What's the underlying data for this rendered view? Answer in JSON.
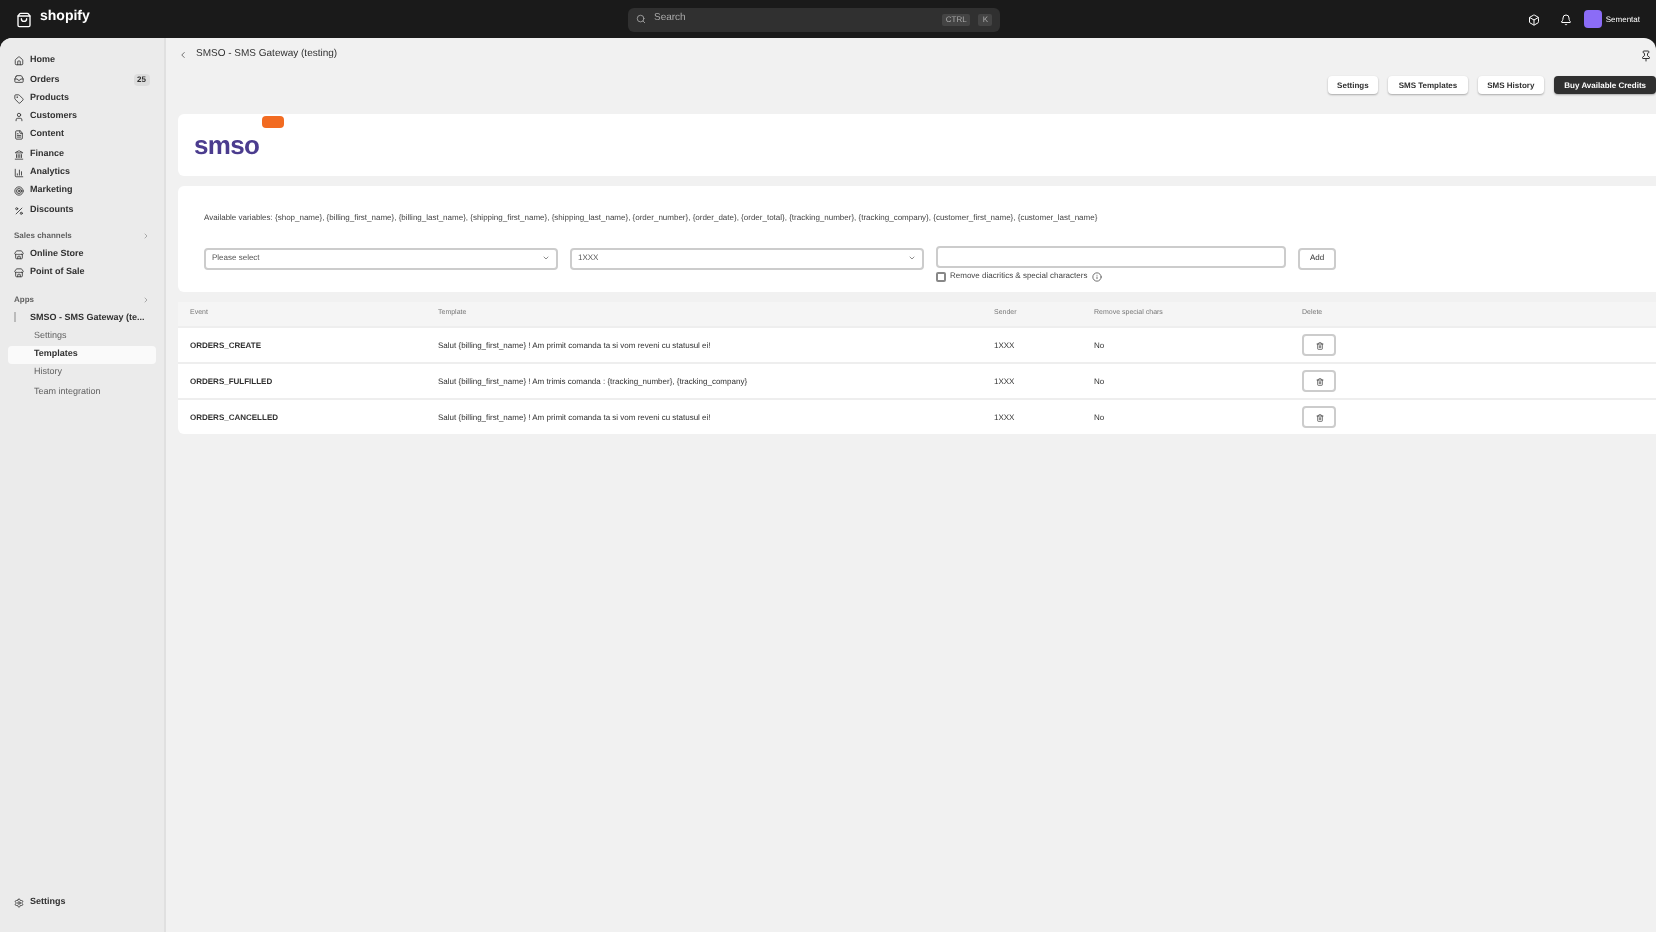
{
  "topbar": {
    "brand": "shopify",
    "search": {
      "placeholder": "Search"
    },
    "shortcut": [
      "CTRL",
      "K"
    ],
    "store": "Sementat"
  },
  "sidebar": {
    "items": [
      {
        "label": "Home"
      },
      {
        "label": "Orders",
        "badge": "25"
      },
      {
        "label": "Products"
      },
      {
        "label": "Customers"
      },
      {
        "label": "Content"
      },
      {
        "label": "Finance"
      },
      {
        "label": "Analytics"
      },
      {
        "label": "Marketing"
      },
      {
        "label": "Discounts"
      }
    ],
    "sections": [
      {
        "title": "Sales channels",
        "items": [
          {
            "label": "Online Store"
          },
          {
            "label": "Point of Sale"
          }
        ]
      },
      {
        "title": "Apps",
        "items": [
          {
            "label": "SMSO - SMS Gateway (te...",
            "children": [
              {
                "label": "Settings",
                "selected": false
              },
              {
                "label": "Templates",
                "selected": true
              },
              {
                "label": "History",
                "selected": false
              },
              {
                "label": "Team integration",
                "selected": false
              }
            ]
          }
        ]
      }
    ],
    "footer": "Settings"
  },
  "page": {
    "title": "SMSO - SMS Gateway (testing)",
    "actions": [
      {
        "label": "Settings",
        "primary": false
      },
      {
        "label": "SMS Templates",
        "primary": false
      },
      {
        "label": "SMS History",
        "primary": false
      },
      {
        "label": "Buy Available Credits",
        "primary": true
      }
    ]
  },
  "logo": "smso",
  "form": {
    "variables": "Available variables: {shop_name}, {billing_first_name}, {billing_last_name}, {shipping_first_name}, {shipping_last_name}, {order_number}, {order_date}, {order_total}, {tracking_number}, {tracking_company}, {customer_first_name}, {customer_last_name}",
    "event_select": "Please select",
    "sender_select": "1XXX",
    "add": "Add",
    "remove_diacritics": {
      "label": "Remove diacritics & special characters",
      "checked": false
    }
  },
  "table": {
    "columns": [
      "Event",
      "Template",
      "Sender",
      "Remove special chars",
      "Delete"
    ],
    "rows": [
      {
        "event": "ORDERS_CREATE",
        "template": "Salut {billing_first_name} ! Am primit comanda ta si vom reveni cu statusul ei!",
        "sender": "1XXX",
        "remove": "No"
      },
      {
        "event": "ORDERS_FULFILLED",
        "template": "Salut {billing_first_name} ! Am trimis comanda : {tracking_number}, {tracking_company}",
        "sender": "1XXX",
        "remove": "No"
      },
      {
        "event": "ORDERS_CANCELLED",
        "template": "Salut {billing_first_name} ! Am primit comanda ta si vom reveni cu statusul ei!",
        "sender": "1XXX",
        "remove": "No"
      }
    ]
  }
}
